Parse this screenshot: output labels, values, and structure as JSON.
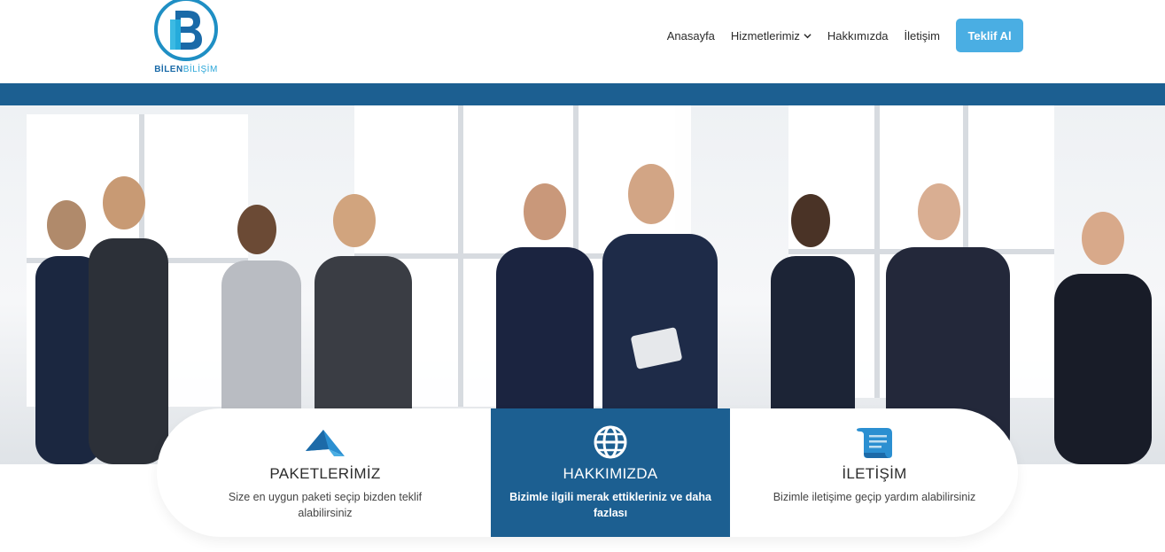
{
  "brand": {
    "logo_word1": "BİLEN",
    "logo_word2": "BİLİŞİM",
    "primary": "#1c5f91",
    "accent": "#4aaee3"
  },
  "nav": {
    "items": [
      "Anasayfa",
      "Hizmetlerimiz",
      "Hakkımızda",
      "İletişim"
    ],
    "dropdown_icon": "chevron-down-icon",
    "cta": "Teklif Al"
  },
  "hero": {
    "image": "business-people-meeting-photo"
  },
  "cards": [
    {
      "icon": "paper-plane-icon",
      "title": "PAKETLERİMİZ",
      "desc": "Size en uygun paketi seçip bizden teklif alabilirsiniz"
    },
    {
      "icon": "globe-icon",
      "title": "HAKKIMIZDA",
      "desc": "Bizimle ilgili merak ettikleriniz ve daha fazlası"
    },
    {
      "icon": "scroll-icon",
      "title": "İLETİŞİM",
      "desc": "Bizimle iletişime geçip yardım alabilirsiniz"
    }
  ]
}
